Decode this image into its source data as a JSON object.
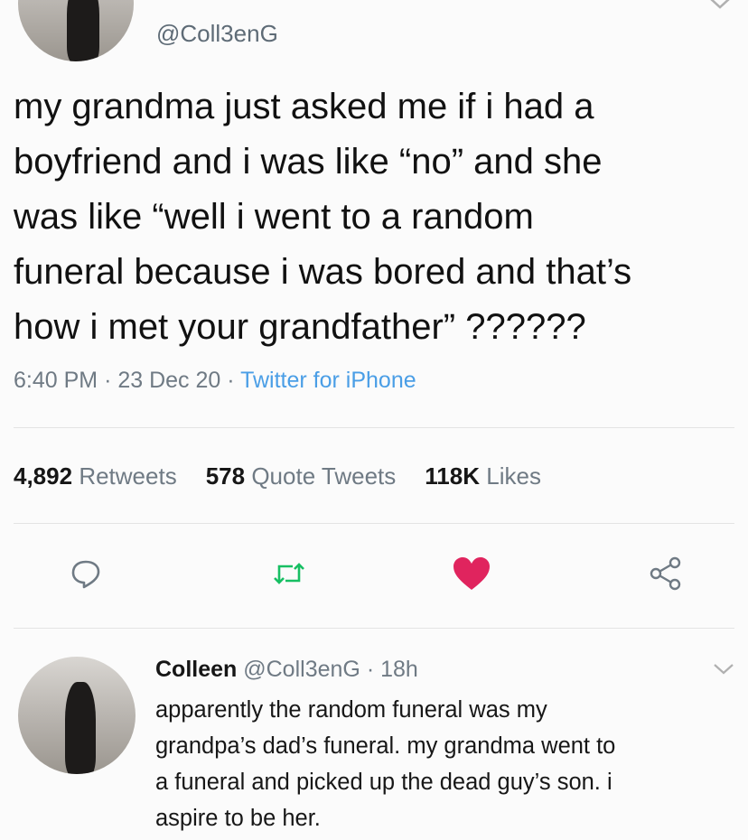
{
  "tweet": {
    "handle": "@Coll3enG",
    "text_lines": [
      "my grandma just asked me if i had a",
      "boyfriend and i was like “no” and she",
      "was like “well i went to a random",
      "funeral because i was bored and that’s",
      "how i met your grandfather” ??????"
    ],
    "time": "6:40 PM",
    "date": "23 Dec 20",
    "source": "Twitter for iPhone",
    "separator": "·"
  },
  "stats": {
    "retweets_count": "4,892",
    "retweets_label": "Retweets",
    "quotes_count": "578",
    "quotes_label": "Quote Tweets",
    "likes_count": "118K",
    "likes_label": "Likes"
  },
  "actions": {
    "reply_icon": "speech-bubble-icon",
    "retweet_icon": "retweet-icon",
    "like_icon": "heart-icon",
    "share_icon": "share-icon",
    "like_color": "#e0245e",
    "retweet_color": "#17bf63"
  },
  "reply": {
    "name": "Colleen",
    "handle": "@Coll3enG",
    "separator": "·",
    "age": "18h",
    "text_lines": [
      "apparently the random funeral was my",
      "grandpa’s dad’s funeral. my grandma went to",
      "a funeral and picked up the dead guy’s son. i",
      "aspire to be her."
    ]
  }
}
